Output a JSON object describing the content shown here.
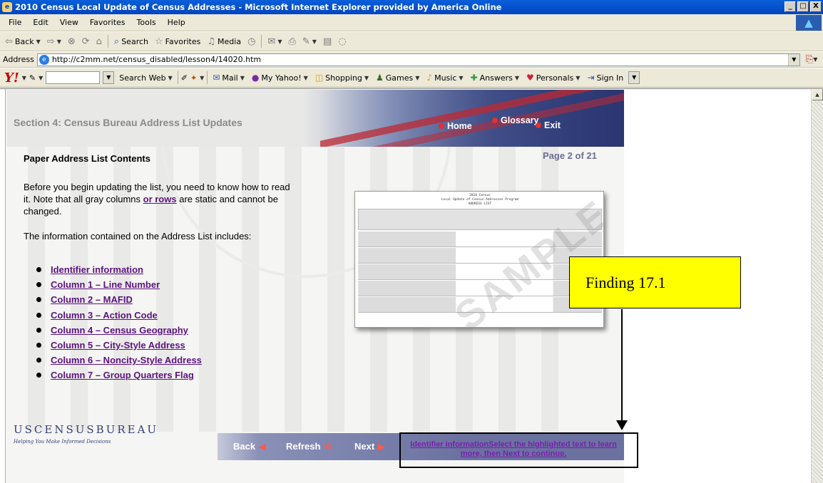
{
  "window": {
    "title": "2010 Census Local Update of Census Addresses - Microsoft Internet Explorer provided by America Online",
    "controls": [
      "_",
      "□",
      "X"
    ]
  },
  "menubar": {
    "items": [
      "File",
      "Edit",
      "View",
      "Favorites",
      "Tools",
      "Help"
    ]
  },
  "toolbar": {
    "back": "Back",
    "search": "Search",
    "favorites": "Favorites",
    "media": "Media"
  },
  "address": {
    "label": "Address",
    "url": "http://c2mm.net/census_disabled/lesson4/14020.htm"
  },
  "yahoo_toolbar": {
    "search_web": "Search Web",
    "mail": "Mail",
    "my_yahoo": "My Yahoo!",
    "shopping": "Shopping",
    "games": "Games",
    "music": "Music",
    "answers": "Answers",
    "personals": "Personals",
    "sign_in": "Sign In"
  },
  "lesson": {
    "section_title": "Section 4: Census Bureau Address List Updates",
    "nav": {
      "home": "Home",
      "glossary": "Glossary",
      "exit": "Exit"
    },
    "page_heading": "Paper Address List Contents",
    "page_count": "Page 2 of 21",
    "intro_part1": "Before you begin updating the list, you need to know how to read it. Note that all gray columns ",
    "intro_link": "or rows",
    "intro_part2": " are static and cannot be changed.",
    "intro2": "The information contained on the Address List includes:",
    "toc": [
      "Identifier information",
      "Column 1 – Line Number",
      "Column 2 – MAFID",
      "Column 3 – Action Code",
      "Column 4 – Census Geography",
      "Column 5 – City-Style Address",
      "Column 6 – Noncity-Style Address",
      "Column 7 – Group Quarters Flag"
    ],
    "doc_thumb": {
      "heading_line1": "2010 Census",
      "heading_line2": "Local Update of Census Addresses Program",
      "heading_line3": "ADDRESS LIST",
      "stamp": "SAMPLE"
    },
    "bureau_logo": "USCENSUSBUREAU",
    "bureau_tagline": "Helping You Make Informed Decisions",
    "bottom_nav": {
      "back": "Back",
      "refresh": "Refresh",
      "next": "Next"
    },
    "status_text": "Identifier informationSelect the highlighted text to learn more, then Next to continue."
  },
  "annotation": {
    "label": "Finding 17.1",
    "color": "#ffff00"
  }
}
